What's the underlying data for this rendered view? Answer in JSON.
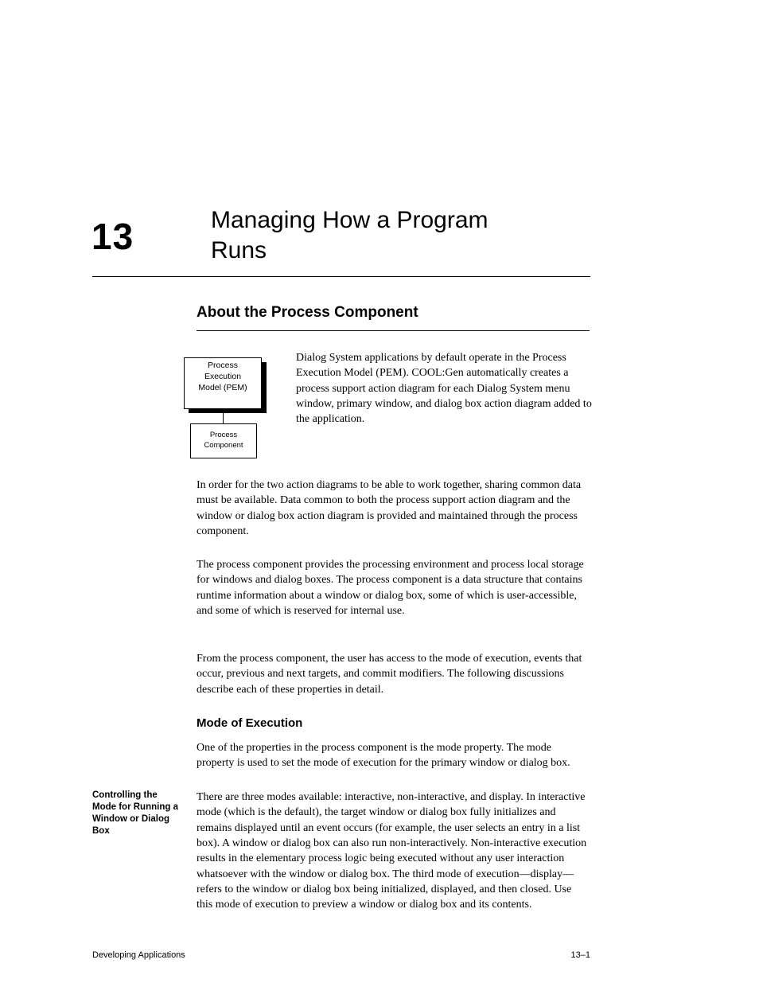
{
  "chapter": {
    "number": "13",
    "title_line1": "Managing How a Program",
    "title_line2": "Runs"
  },
  "section_title": "About the Process Component",
  "diagram": {
    "parent_line1": "Process",
    "parent_line2": "Execution",
    "parent_line3": "Model (PEM)",
    "child_line1": "Process",
    "child_line2": "Component",
    "paragraph": "Dialog System applications by default operate in the Process Execution Model (PEM). COOL:Gen automatically creates a process support action diagram for each Dialog System menu window, primary window, and dialog box action diagram added to the application."
  },
  "body_p1": "In order for the two action diagrams to be able to work together, sharing common data must be available. Data common to both the process support action diagram and the window or dialog box action diagram is provided and maintained through the process component.",
  "body_p2": "The process component provides the processing environment and process local storage for windows and dialog boxes. The process component is a data structure that contains runtime information about a window or dialog box, some of which is user-accessible, and some of which is reserved for internal use.",
  "body_p3": "From the process component, the user has access to the mode of execution, events that occur, previous and next targets, and commit modifiers. The following discussions describe each of these properties in detail.",
  "heading_mode": "Mode of Execution",
  "mode_p1": "One of the properties in the process component is the mode property. The mode property is used to set the mode of execution for the primary window or dialog box.",
  "margin_note": "Controlling the Mode for Running a Window or Dialog Box",
  "mode_p2": "There are three modes available: interactive, non-interactive, and display. In interactive mode (which is the default), the target window or dialog box fully initializes and remains displayed until an event occurs (for example, the user selects an entry in a list box). A window or dialog box can also run non-interactively. Non-interactive execution results in the elementary process logic being executed without any user interaction whatsoever with the window or dialog box. The third mode of execution—display—refers to the window or dialog box being initialized, displayed, and then closed. Use this mode of execution to preview a window or dialog box and its contents.",
  "footer": {
    "left": "Developing Applications",
    "right": "13–1"
  }
}
